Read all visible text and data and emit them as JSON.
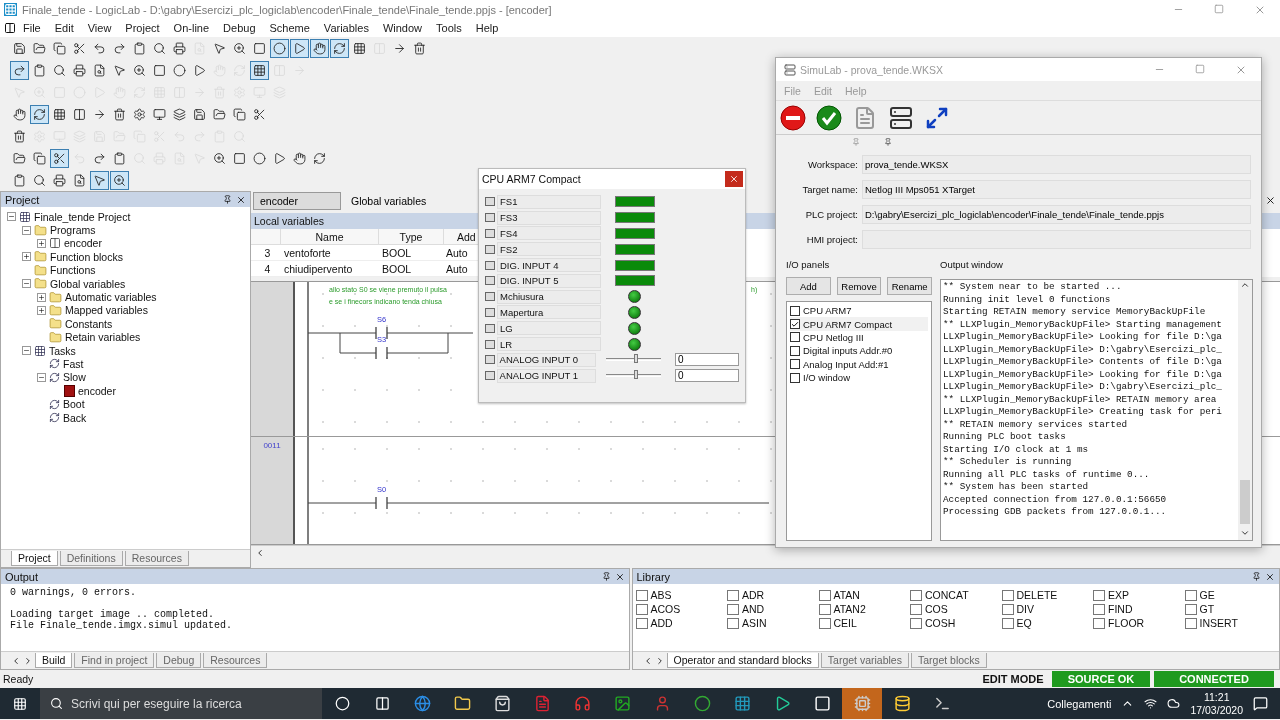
{
  "window": {
    "title": "Finale_tende - LogicLab - D:\\gabry\\Esercizi_plc_logiclab\\encoder\\Finale_tende\\Finale_tende.ppjs - [encoder]"
  },
  "menu": [
    "File",
    "Edit",
    "View",
    "Project",
    "On-line",
    "Debug",
    "Scheme",
    "Variables",
    "Window",
    "Tools",
    "Help"
  ],
  "toolbars": [
    {
      "buttons": [
        {
          "pressed": false,
          "disabled": false
        },
        {
          "pressed": false,
          "disabled": false
        },
        {
          "pressed": false,
          "disabled": false
        },
        {
          "pressed": false,
          "disabled": false
        },
        {
          "pressed": false,
          "disabled": false
        },
        {
          "pressed": false,
          "disabled": false
        },
        {
          "pressed": false,
          "disabled": false
        },
        {
          "pressed": false,
          "disabled": false
        },
        {
          "pressed": false,
          "disabled": false
        },
        {
          "pressed": false,
          "disabled": true
        },
        {
          "pressed": false,
          "disabled": false
        },
        {
          "pressed": false,
          "disabled": false
        },
        {
          "pressed": false,
          "disabled": false
        },
        {
          "pressed": true,
          "disabled": false
        },
        {
          "pressed": true,
          "disabled": false
        },
        {
          "pressed": true,
          "disabled": false
        },
        {
          "pressed": true,
          "disabled": false
        },
        {
          "pressed": false,
          "disabled": false
        },
        {
          "pressed": false,
          "disabled": true
        },
        {
          "pressed": false,
          "disabled": false
        },
        {
          "pressed": false,
          "disabled": false
        }
      ]
    },
    {
      "buttons": [
        {
          "pressed": true,
          "disabled": false
        },
        {
          "pressed": false,
          "disabled": false
        },
        {
          "pressed": false,
          "disabled": false
        },
        {
          "pressed": false,
          "disabled": false
        },
        {
          "pressed": false,
          "disabled": false
        },
        {
          "pressed": false,
          "disabled": false
        },
        {
          "pressed": false,
          "disabled": false
        },
        {
          "pressed": false,
          "disabled": false
        },
        {
          "pressed": false,
          "disabled": false
        },
        {
          "pressed": false,
          "disabled": false
        },
        {
          "pressed": false,
          "disabled": true
        },
        {
          "pressed": false,
          "disabled": true
        },
        {
          "pressed": true,
          "disabled": false
        },
        {
          "pressed": false,
          "disabled": true
        },
        {
          "pressed": false,
          "disabled": true
        }
      ]
    },
    {
      "buttons": [
        {
          "pressed": false,
          "disabled": true
        },
        {
          "pressed": false,
          "disabled": true
        },
        {
          "pressed": false,
          "disabled": true
        },
        {
          "pressed": false,
          "disabled": true
        },
        {
          "pressed": false,
          "disabled": true
        },
        {
          "pressed": false,
          "disabled": true
        },
        {
          "pressed": false,
          "disabled": true
        },
        {
          "pressed": false,
          "disabled": true
        },
        {
          "pressed": false,
          "disabled": true
        },
        {
          "pressed": false,
          "disabled": true
        },
        {
          "pressed": false,
          "disabled": true
        },
        {
          "pressed": false,
          "disabled": true
        },
        {
          "pressed": false,
          "disabled": true
        },
        {
          "pressed": false,
          "disabled": true
        }
      ]
    },
    {
      "buttons": [
        {
          "pressed": false,
          "disabled": false
        },
        {
          "pressed": true,
          "disabled": false
        },
        {
          "pressed": false,
          "disabled": false
        },
        {
          "pressed": false,
          "disabled": false
        },
        {
          "pressed": false,
          "disabled": false
        },
        {
          "pressed": false,
          "disabled": false
        },
        {
          "pressed": false,
          "disabled": false
        },
        {
          "pressed": false,
          "disabled": false
        },
        {
          "pressed": false,
          "disabled": false
        },
        {
          "pressed": false,
          "disabled": false
        },
        {
          "pressed": false,
          "disabled": false
        },
        {
          "pressed": false,
          "disabled": false
        },
        {
          "pressed": false,
          "disabled": false
        }
      ]
    },
    {
      "buttons": [
        {
          "pressed": false,
          "disabled": false
        },
        {
          "pressed": false,
          "disabled": true
        },
        {
          "pressed": false,
          "disabled": true
        },
        {
          "pressed": false,
          "disabled": true
        },
        {
          "pressed": false,
          "disabled": true
        },
        {
          "pressed": false,
          "disabled": true
        },
        {
          "pressed": false,
          "disabled": true
        },
        {
          "pressed": false,
          "disabled": true
        },
        {
          "pressed": false,
          "disabled": true
        },
        {
          "pressed": false,
          "disabled": true
        },
        {
          "pressed": false,
          "disabled": true
        },
        {
          "pressed": false,
          "disabled": true
        }
      ]
    },
    {
      "buttons": [
        {
          "pressed": false,
          "disabled": false
        },
        {
          "pressed": false,
          "disabled": false
        },
        {
          "pressed": true,
          "disabled": false
        },
        {
          "pressed": false,
          "disabled": true
        },
        {
          "pressed": false,
          "disabled": false
        },
        {
          "pressed": false,
          "disabled": false
        },
        {
          "pressed": false,
          "disabled": true
        },
        {
          "pressed": false,
          "disabled": true
        },
        {
          "pressed": false,
          "disabled": true
        },
        {
          "pressed": false,
          "disabled": true
        },
        {
          "pressed": false,
          "disabled": false
        },
        {
          "pressed": false,
          "disabled": false
        },
        {
          "pressed": false,
          "disabled": false
        },
        {
          "pressed": false,
          "disabled": false
        },
        {
          "pressed": false,
          "disabled": false
        },
        {
          "pressed": false,
          "disabled": false
        }
      ]
    },
    {
      "buttons": [
        {
          "pressed": false,
          "disabled": false
        },
        {
          "pressed": false,
          "disabled": false
        },
        {
          "pressed": false,
          "disabled": false
        },
        {
          "pressed": false,
          "disabled": false
        },
        {
          "pressed": true,
          "disabled": false
        },
        {
          "pressed": true,
          "disabled": false
        }
      ]
    }
  ],
  "project_panel": {
    "title": "Project",
    "tree": [
      {
        "label": "Finale_tende Project",
        "kind": "project",
        "expanded": true,
        "children": [
          {
            "label": "Programs",
            "kind": "folder",
            "expanded": true,
            "children": [
              {
                "label": "encoder",
                "kind": "program",
                "expanded": false
              }
            ]
          },
          {
            "label": "Function blocks",
            "kind": "folder",
            "expanded": false
          },
          {
            "label": "Functions",
            "kind": "folder"
          },
          {
            "label": "Global variables",
            "kind": "folder",
            "expanded": true,
            "children": [
              {
                "label": "Automatic variables",
                "kind": "folder",
                "expanded": false
              },
              {
                "label": "Mapped variables",
                "kind": "folder",
                "expanded": false
              },
              {
                "label": "Constants",
                "kind": "folder"
              },
              {
                "label": "Retain variables",
                "kind": "folder"
              }
            ]
          },
          {
            "label": "Tasks",
            "kind": "project",
            "expanded": true,
            "children": [
              {
                "label": "Fast",
                "kind": "task"
              },
              {
                "label": "Slow",
                "kind": "task",
                "expanded": true,
                "children": [
                  {
                    "label": "encoder",
                    "kind": "pou"
                  }
                ]
              },
              {
                "label": "Boot",
                "kind": "task"
              },
              {
                "label": "Back",
                "kind": "task"
              }
            ]
          }
        ]
      }
    ],
    "tabs": [
      {
        "label": "Project",
        "selected": true
      },
      {
        "label": "Definitions",
        "selected": false
      },
      {
        "label": "Resources",
        "selected": false
      }
    ]
  },
  "editor": {
    "tabs": [
      {
        "label": "encoder",
        "selected": true
      },
      {
        "label": "Global variables",
        "selected": false
      }
    ],
    "local_variables": {
      "title": "Local variables",
      "columns": [
        "Name",
        "Type",
        "Add"
      ],
      "rows": [
        {
          "index": "3",
          "name": "ventoforte",
          "type": "BOOL",
          "address": "Auto"
        },
        {
          "index": "4",
          "name": "chiudipervento",
          "type": "BOOL",
          "address": "Auto"
        }
      ]
    },
    "ladder": {
      "comments": [
        "allo stato S0 se viene premuto il pulsa",
        "e se i finecors indicano tenda chiusa"
      ],
      "comment_tail": "h)",
      "rungs": [
        {
          "contacts": [
            "S6",
            "S3"
          ]
        },
        {
          "number": "0011",
          "contacts": [
            "S0"
          ]
        }
      ]
    }
  },
  "cpu_panel": {
    "title": "CPU ARM7 Compact",
    "items": [
      {
        "name": "FS1",
        "kind": "bar",
        "on": true
      },
      {
        "name": "FS3",
        "kind": "bar",
        "on": true
      },
      {
        "name": "FS4",
        "kind": "bar",
        "on": true
      },
      {
        "name": "FS2",
        "kind": "bar",
        "on": true
      },
      {
        "name": "DIG. INPUT 4",
        "kind": "bar",
        "on": true
      },
      {
        "name": "DIG. INPUT 5",
        "kind": "bar",
        "on": true
      },
      {
        "name": "Mchiusura",
        "kind": "led",
        "on": true
      },
      {
        "name": "Mapertura",
        "kind": "led",
        "on": true
      },
      {
        "name": "LG",
        "kind": "led",
        "on": true
      },
      {
        "name": "LR",
        "kind": "led",
        "on": true
      },
      {
        "name": "ANALOG INPUT 0",
        "kind": "slider",
        "level": 0.55,
        "value": "0"
      },
      {
        "name": "ANALOG INPUT 1",
        "kind": "slider",
        "level": 0.55,
        "value": "0"
      }
    ]
  },
  "simulab": {
    "title": "SimuLab - prova_tende.WKSX",
    "menu": [
      "File",
      "Edit",
      "Help"
    ],
    "fields": [
      {
        "label": "Workspace:",
        "value": "prova_tende.WKSX"
      },
      {
        "label": "Target name:",
        "value": "Netlog III Mps051 XTarget"
      },
      {
        "label": "PLC project:",
        "value": "D:\\gabry\\Esercizi_plc_logiclab\\encoder\\Finale_tende\\Finale_tende.ppjs"
      },
      {
        "label": "HMI project:"
      }
    ],
    "io_panels": {
      "title": "I/O panels",
      "buttons": [
        "Add",
        "Remove",
        "Rename"
      ],
      "items": [
        {
          "label": "CPU ARM7",
          "checked": false
        },
        {
          "label": "CPU ARM7 Compact",
          "checked": true
        },
        {
          "label": "CPU Netlog III",
          "checked": false
        },
        {
          "label": "Digital inputs Addr.#0",
          "checked": false
        },
        {
          "label": "Analog Input Add:#1",
          "checked": false
        },
        {
          "label": "I/O window",
          "checked": false
        }
      ]
    },
    "output": {
      "title": "Output window",
      "lines": [
        "** System near to be started ...",
        "Running init level 0 functions",
        "Starting RETAIN memory service MemoryBackUpFile",
        "** LLXPlugin_MemoryBackUpFile> Starting management",
        "LLXPlugin_MemoryBackUpFile> Looking for file D:\\ga",
        "LLXPlugin_MemoryBackUpFile> D:\\gabry\\Esercizi_plc_",
        "LLXPlugin_MemoryBackUpFile> Contents of file D:\\ga",
        "LLXPlugin_MemoryBackUpFile> Looking for file D:\\ga",
        "LLXPlugin_MemoryBackUpFile> D:\\gabry\\Esercizi_plc_",
        "** LLXPlugin_MemoryBackUpFile> RETAIN memory area",
        "LLXPlugin_MemoryBackUpFile> Creating task for peri",
        "** RETAIN memory services started",
        "Running PLC boot tasks",
        "Starting I/O clock at 1 ms",
        "** Scheduler is running",
        "Running all PLC tasks of runtime 0...",
        "** System has been started",
        "Accepted connection from 127.0.0.1:56650",
        "Processing GDB packets from 127.0.0.1..."
      ]
    }
  },
  "output_panel": {
    "title": "Output",
    "paragraphs": [
      [
        "0 warnings, 0 errors."
      ],
      [
        "Loading target image .. completed.",
        "File Finale_tende.imgx.simul updated."
      ]
    ],
    "tabs": [
      {
        "label": "Build",
        "selected": true
      },
      {
        "label": "Find in project",
        "selected": false
      },
      {
        "label": "Debug",
        "selected": false
      },
      {
        "label": "Resources",
        "selected": false
      }
    ]
  },
  "library": {
    "title": "Library",
    "items": [
      "ABS",
      "ACOS",
      "ADD",
      "ADR",
      "AND",
      "ASIN",
      "ATAN",
      "ATAN2",
      "CEIL",
      "CONCAT",
      "COS",
      "COSH",
      "DELETE",
      "DIV",
      "EQ",
      "EXP",
      "FIND",
      "FLOOR",
      "GE",
      "GT",
      "INSERT"
    ],
    "tabs": [
      {
        "label": "Operator and standard blocks",
        "selected": true
      },
      {
        "label": "Target variables",
        "selected": false
      },
      {
        "label": "Target blocks",
        "selected": false
      }
    ]
  },
  "status_bar": {
    "text": "Ready",
    "items": [
      {
        "label": "EDIT MODE"
      },
      {
        "label": "SOURCE OK",
        "color": "#1f9a1f"
      },
      {
        "label": "CONNECTED",
        "color": "#1f9a1f"
      }
    ]
  },
  "taskbar": {
    "search": {
      "placeholder": "Scrivi qui per eseguire la ricerca"
    },
    "apps": [
      {
        "active": false
      },
      {
        "active": false
      },
      {
        "active": false
      },
      {
        "active": false
      },
      {
        "active": false
      },
      {
        "active": false
      },
      {
        "active": false
      },
      {
        "active": false
      },
      {
        "active": false
      },
      {
        "active": false
      },
      {
        "active": false
      },
      {
        "active": true
      },
      {
        "active": false
      },
      {
        "active": false
      }
    ],
    "toolbar_label": "Collegamenti",
    "time": "11:21",
    "date": "17/03/2020"
  }
}
